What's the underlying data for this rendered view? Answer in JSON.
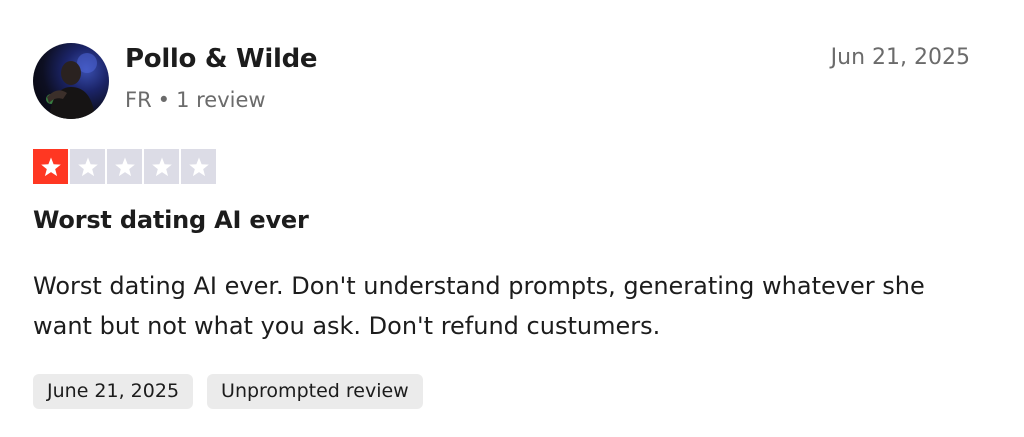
{
  "reviewer": {
    "name": "Pollo & Wilde",
    "country": "FR",
    "separator": "•",
    "review_count": "1 review"
  },
  "review": {
    "date": "Jun 21, 2025",
    "rating": 1,
    "rating_max": 5,
    "title": "Worst dating AI ever",
    "body": "Worst dating AI ever. Don't understand prompts, generating whatever she want but not what you ask. Don't refund custumers.",
    "experience_date": "June 21, 2025",
    "tag": "Unprompted review"
  },
  "colors": {
    "star_filled": "#ff3722",
    "star_empty": "#dcdce6",
    "tag_bg": "#ebebeb",
    "muted_text": "#6b6b6b"
  },
  "icons": {
    "avatar": "user-avatar-photo",
    "star": "star-icon"
  }
}
